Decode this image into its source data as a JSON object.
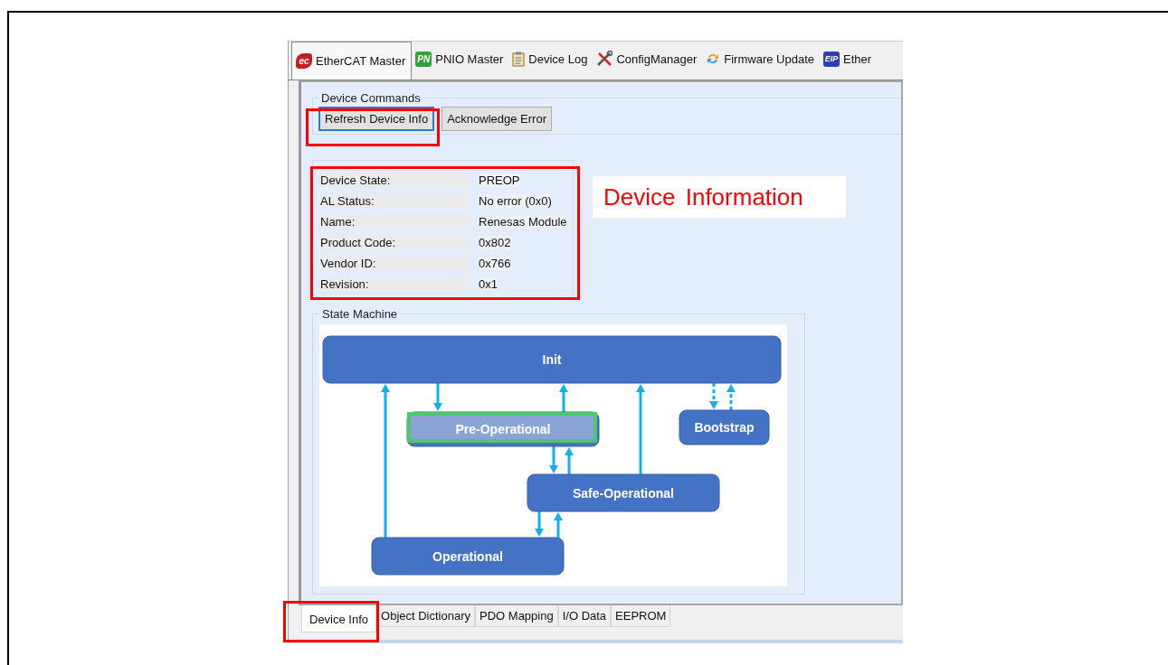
{
  "top_tabs": [
    {
      "label": "EtherCAT Master",
      "badge": "ec",
      "selected": true
    },
    {
      "label": "PNIO Master",
      "badge": "PN",
      "selected": false
    },
    {
      "label": "Device Log",
      "selected": false
    },
    {
      "label": "ConfigManager",
      "selected": false
    },
    {
      "label": "Firmware Update",
      "selected": false
    },
    {
      "label": "Ether",
      "badge": "EIP",
      "selected": false
    }
  ],
  "device_commands": {
    "title": "Device Commands",
    "buttons": [
      {
        "label": "Refresh Device Info",
        "focused": true
      },
      {
        "label": "Acknowledge Error",
        "focused": false
      }
    ]
  },
  "device_info": [
    {
      "label": "Device State:",
      "value": "PREOP"
    },
    {
      "label": "AL Status:",
      "value": "No error (0x0)"
    },
    {
      "label": "Name:",
      "value": "Renesas Module"
    },
    {
      "label": "Product Code:",
      "value": "0x802"
    },
    {
      "label": "Vendor ID:",
      "value": "0x766"
    },
    {
      "label": "Revision:",
      "value": "0x1"
    }
  ],
  "state_machine": {
    "title": "State Machine",
    "states": [
      {
        "label": "Init",
        "selected": false
      },
      {
        "label": "Pre-Operational",
        "selected": true
      },
      {
        "label": "Bootstrap",
        "selected": false
      },
      {
        "label": "Safe-Operational",
        "selected": false
      },
      {
        "label": "Operational",
        "selected": false
      }
    ]
  },
  "bottom_tabs": [
    {
      "label": "Device Info",
      "selected": true
    },
    {
      "label": "Object Dictionary",
      "selected": false
    },
    {
      "label": "PDO Mapping",
      "selected": false
    },
    {
      "label": "I/O Data",
      "selected": false
    },
    {
      "label": "EEPROM",
      "selected": false
    }
  ],
  "annotation": {
    "text": "Device Information"
  }
}
